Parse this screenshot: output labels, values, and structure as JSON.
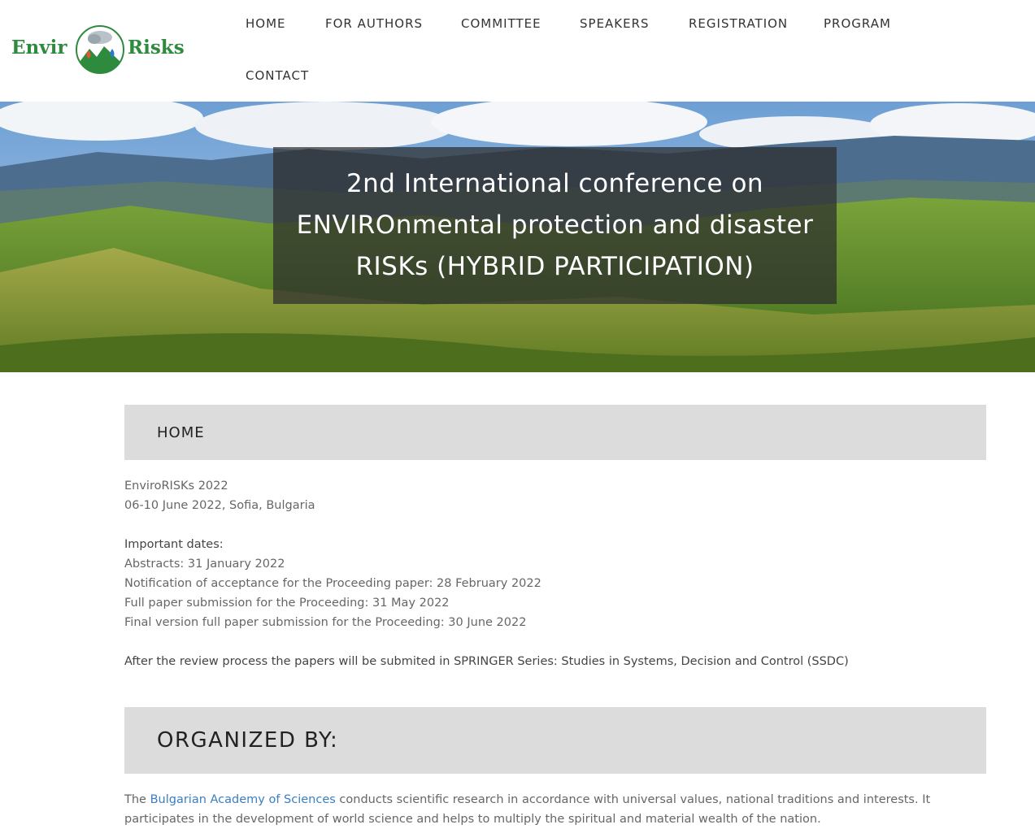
{
  "logo": {
    "word_left": "Envir",
    "word_right": "Risks"
  },
  "nav": {
    "items": [
      "HOME",
      "FOR AUTHORS",
      "COMMITTEE",
      "SPEAKERS",
      "REGISTRATION",
      "PROGRAM",
      "CONTACT"
    ]
  },
  "hero": {
    "title": "2nd International conference on ENVIROnmental protection and disaster RISKs (HYBRID PARTICIPATION)"
  },
  "home": {
    "heading": "HOME",
    "event_name": "EnviroRISKs 2022",
    "event_date_place": "06-10 June 2022, Sofia, Bulgaria",
    "dates_heading": "Important dates:",
    "dates": [
      "Abstracts: 31 January 2022",
      "Notification of acceptance for the Proceeding paper: 28 February 2022",
      "Full paper submission for the Proceeding: 31 May 2022",
      "Final version full paper submission for the Proceeding: 30 June 2022"
    ],
    "springer_note": "After the review process the papers will be submited in SPRINGER Series: Studies in Systems, Decision and Control (SSDC)"
  },
  "organized": {
    "heading": "ORGANIZED BY:",
    "intro": "The ",
    "link": "Bulgarian Academy of Sciences",
    "rest": " conducts scientific research in accordance with universal values, national traditions and interests. It participates in the development of world science and helps to multiply the spiritual and material wealth of the nation."
  }
}
